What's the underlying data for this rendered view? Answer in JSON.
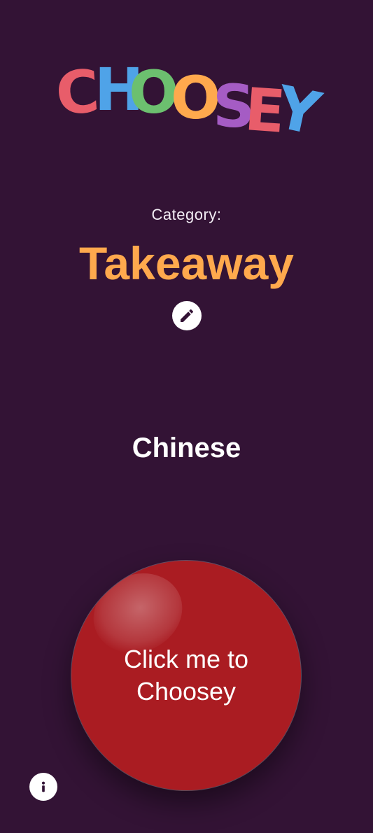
{
  "app": {
    "logo_letters": [
      {
        "char": "C",
        "color": "#E85D6A"
      },
      {
        "char": "H",
        "color": "#4FA3E8"
      },
      {
        "char": "O",
        "color": "#6CC06F"
      },
      {
        "char": "O",
        "color": "#FFA94D"
      },
      {
        "char": "S",
        "color": "#A55CC4"
      },
      {
        "char": "E",
        "color": "#E85D6A"
      },
      {
        "char": "Y",
        "color": "#4FA3E8"
      }
    ]
  },
  "category": {
    "label": "Category:",
    "value": "Takeaway",
    "edit_icon": "pencil-icon"
  },
  "result": {
    "value": "Chinese"
  },
  "choose_button": {
    "label": "Click me to Choosey",
    "color": "#AA1C22"
  },
  "info_button": {
    "icon": "info-icon"
  },
  "colors": {
    "background": "#331335",
    "accent": "#FFA94D"
  }
}
